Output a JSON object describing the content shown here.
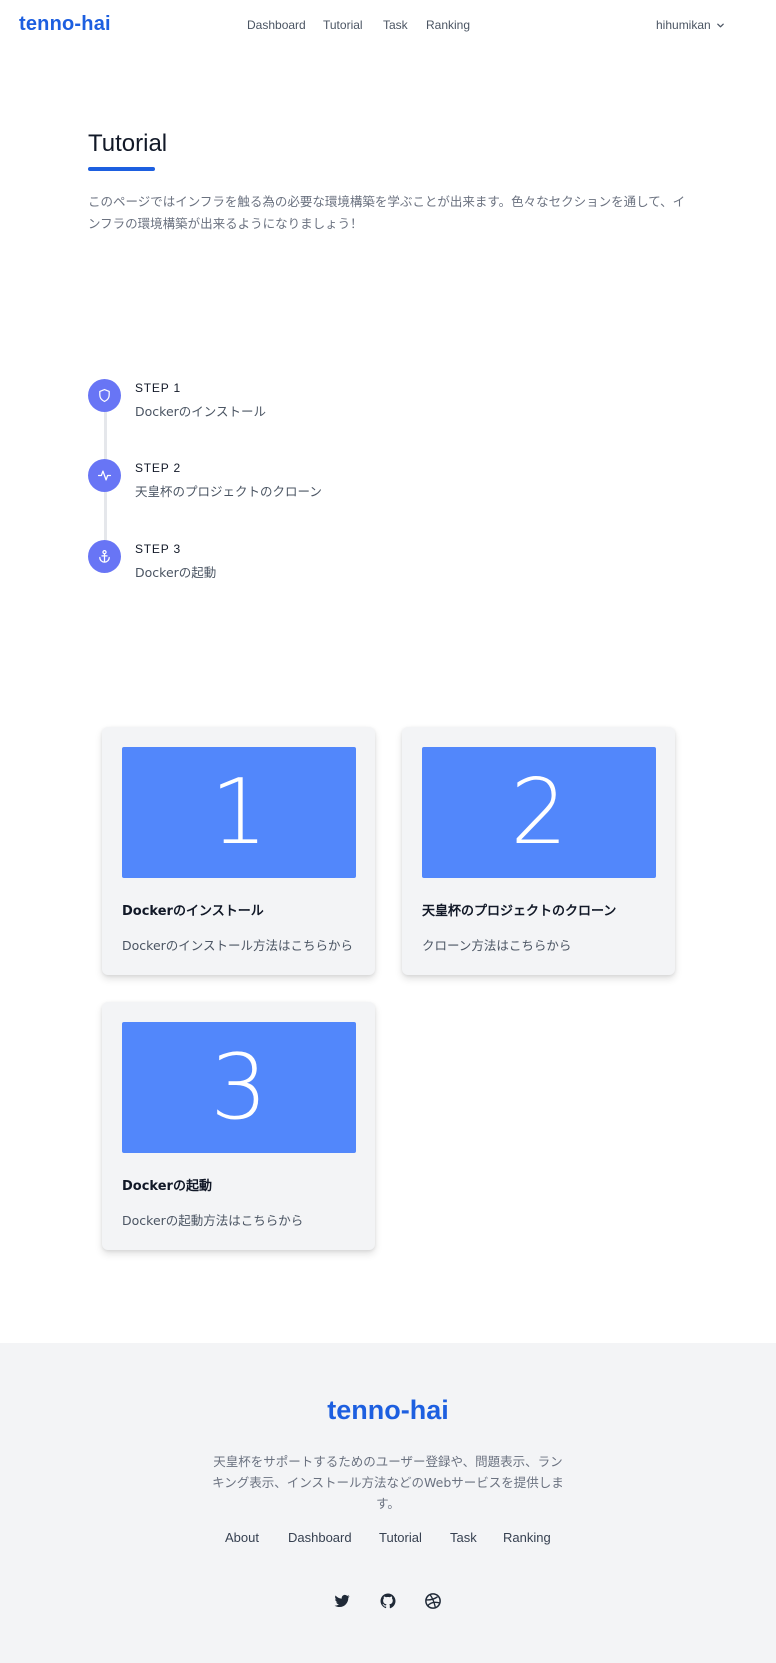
{
  "header": {
    "brand": "tenno-hai",
    "nav": [
      "Dashboard",
      "Tutorial",
      "Task",
      "Ranking"
    ],
    "user": "hihumikan"
  },
  "intro": {
    "title": "Tutorial",
    "text": "このページではインフラを触る為の必要な環境構築を学ぶことが出来ます。色々なセクションを通して、インフラの環境構築が出来るようになりましょう！"
  },
  "steps": [
    {
      "label": "STEP 1",
      "text": "Dockerのインストール",
      "icon": "shield-icon"
    },
    {
      "label": "STEP 2",
      "text": "天皇杯のプロジェクトのクローン",
      "icon": "activity-icon"
    },
    {
      "label": "STEP 3",
      "text": "Dockerの起動",
      "icon": "anchor-icon"
    }
  ],
  "cards": [
    {
      "number": "1",
      "title": "Dockerのインストール",
      "desc": "Dockerのインストール方法はこちらから"
    },
    {
      "number": "2",
      "title": "天皇杯のプロジェクトのクローン",
      "desc": "クローン方法はこちらから"
    },
    {
      "number": "3",
      "title": "Dockerの起動",
      "desc": "Dockerの起動方法はこちらから"
    }
  ],
  "footer": {
    "brand": "tenno-hai",
    "desc": "天皇杯をサポートするためのユーザー登録や、問題表示、ランキング表示、インストール方法などのWebサービスを提供します。",
    "nav": [
      "About",
      "Dashboard",
      "Tutorial",
      "Task",
      "Ranking"
    ],
    "social": [
      "twitter-icon",
      "github-icon",
      "dribbble-icon"
    ]
  },
  "colors": {
    "brand": "#1d5fe0",
    "step_circle": "#6875f5",
    "card_image": "#5287fb",
    "footer_bg": "#f3f4f6"
  }
}
